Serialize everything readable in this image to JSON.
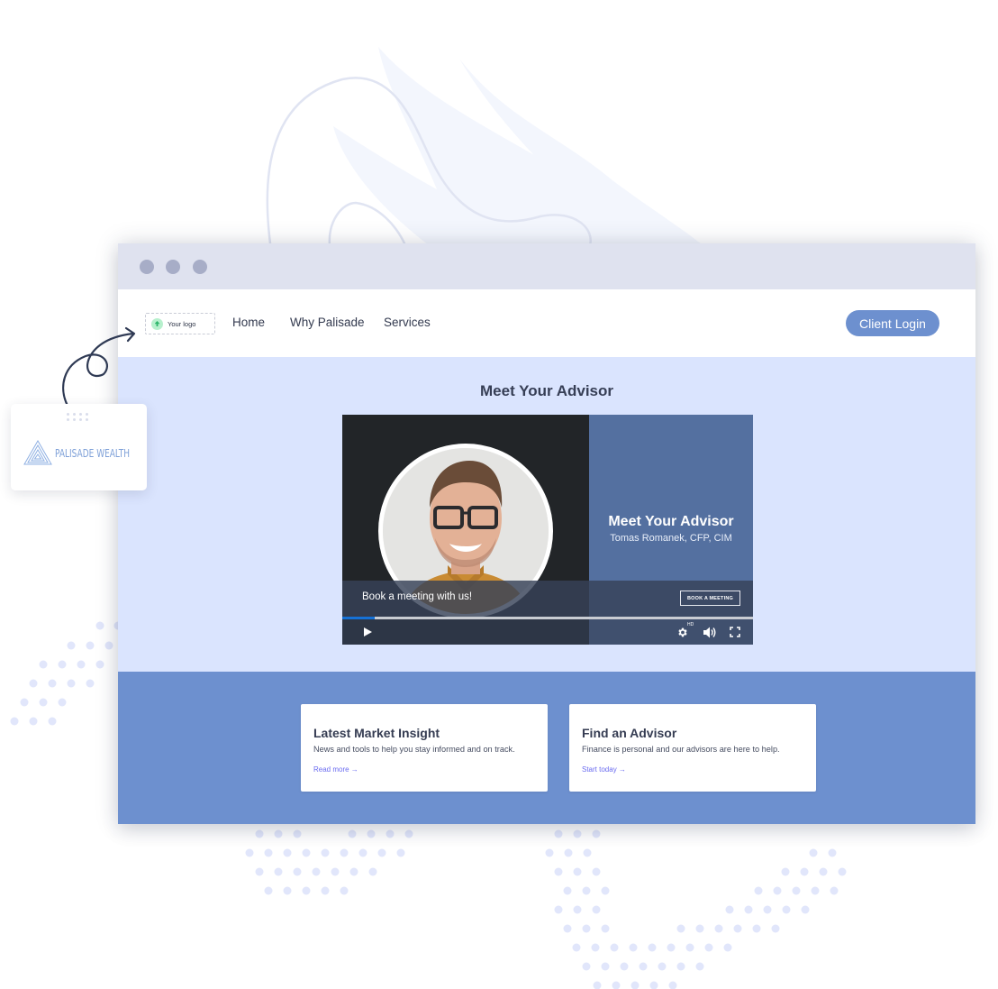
{
  "colors": {
    "titlebar": "#dfe2ef",
    "hero_bg": "#dae4fe",
    "features_bg": "#6d90cf",
    "accent_button": "#6d90cf",
    "video_panel": "#5470a0",
    "progress": "#1671d6",
    "link": "#6b6cf0"
  },
  "browser": {
    "window_controls": [
      "close-dot",
      "minimize-dot",
      "maximize-dot"
    ]
  },
  "navbar": {
    "logo_placeholder": "Your logo",
    "links": [
      "Home",
      "Why Palisade",
      "Services"
    ],
    "login_label": "Client Login"
  },
  "hero": {
    "title": "Meet Your Advisor",
    "video": {
      "panel_title": "Meet Your Advisor",
      "panel_subtitle": "Tomas Romanek, CFP, CIM",
      "caption": "Book a meeting with us!",
      "cta_label": "BOOK A MEETING",
      "progress_fraction": 0.08,
      "quality_badge": "HD",
      "controls": [
        "play-icon",
        "settings-icon",
        "volume-icon",
        "fullscreen-icon"
      ]
    }
  },
  "features": {
    "cards": [
      {
        "title": "Latest Market Insight",
        "description": "News and tools to help you stay informed and on track.",
        "link": "Read more →"
      },
      {
        "title": "Find an Advisor",
        "description": "Finance is personal and our advisors are here to help.",
        "link": "Start today →"
      }
    ]
  },
  "brand_card": {
    "name": "PALISADE WEALTH",
    "icon": "triangle-logo-icon"
  }
}
